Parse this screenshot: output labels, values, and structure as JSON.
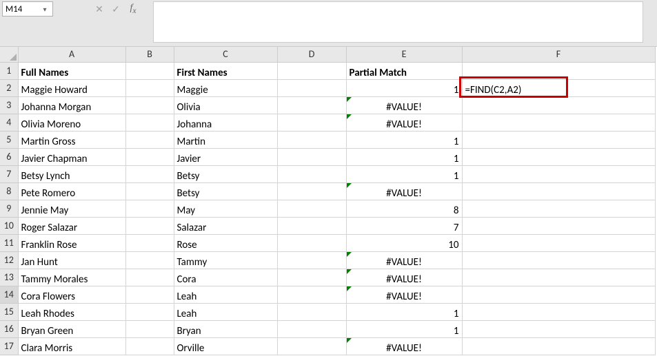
{
  "name_box": "M14",
  "formula_input": "",
  "col_headers": [
    "A",
    "B",
    "C",
    "D",
    "E",
    "F"
  ],
  "col_widths": [
    "col-A",
    "col-B",
    "col-C",
    "col-D",
    "col-E",
    "col-F"
  ],
  "rows": [
    {
      "n": 1,
      "A": "Full Names",
      "C": "First Names",
      "E": "Partial Match",
      "bold": true
    },
    {
      "n": 2,
      "A": "Maggie Howard",
      "C": "Maggie",
      "E": "1",
      "E_right": true,
      "F": "=FIND(C2,A2)",
      "hl": true
    },
    {
      "n": 3,
      "A": "Johanna Morgan",
      "C": "Olivia",
      "E": "#VALUE!",
      "E_center": true,
      "E_err": true
    },
    {
      "n": 4,
      "A": "Olivia Moreno",
      "C": "Johanna",
      "E": "#VALUE!",
      "E_center": true,
      "E_err": true
    },
    {
      "n": 5,
      "A": "Martin Gross",
      "C": "Martin",
      "E": "1",
      "E_right": true
    },
    {
      "n": 6,
      "A": "Javier Chapman",
      "C": "Javier",
      "E": "1",
      "E_right": true
    },
    {
      "n": 7,
      "A": "Betsy Lynch",
      "C": "Betsy",
      "E": "1",
      "E_right": true
    },
    {
      "n": 8,
      "A": "Pete Romero",
      "C": "Betsy",
      "E": "#VALUE!",
      "E_center": true,
      "E_err": true
    },
    {
      "n": 9,
      "A": "Jennie May",
      "C": "May",
      "E": "8",
      "E_right": true
    },
    {
      "n": 10,
      "A": "Roger Salazar",
      "C": "Salazar",
      "E": "7",
      "E_right": true
    },
    {
      "n": 11,
      "A": "Franklin Rose",
      "C": "Rose",
      "E": "10",
      "E_right": true
    },
    {
      "n": 12,
      "A": "Jan Hunt",
      "C": "Tammy",
      "E": "#VALUE!",
      "E_center": true,
      "E_err": true
    },
    {
      "n": 13,
      "A": "Tammy Morales",
      "C": "Cora",
      "E": "#VALUE!",
      "E_center": true,
      "E_err": true
    },
    {
      "n": 14,
      "A": "Cora Flowers",
      "C": "Leah",
      "E": "#VALUE!",
      "E_center": true,
      "E_err": true,
      "sel": true
    },
    {
      "n": 15,
      "A": "Leah Rhodes",
      "C": "Leah",
      "E": "1",
      "E_right": true
    },
    {
      "n": 16,
      "A": "Bryan Green",
      "C": "Bryan",
      "E": "1",
      "E_right": true
    },
    {
      "n": 17,
      "A": "Clara Morris",
      "C": "Orville",
      "E": "#VALUE!",
      "E_center": true,
      "E_err": true
    }
  ],
  "icons": {
    "cancel": "✕",
    "enter": "✓",
    "dd": "▾"
  },
  "chart_data": {
    "type": "table",
    "title": "FIND partial-match example",
    "columns": [
      "Full Names",
      "First Names",
      "Partial Match"
    ],
    "annotation_formula": "=FIND(C2,A2)",
    "data": [
      {
        "full": "Maggie Howard",
        "first": "Maggie",
        "match": 1
      },
      {
        "full": "Johanna Morgan",
        "first": "Olivia",
        "match": "#VALUE!"
      },
      {
        "full": "Olivia Moreno",
        "first": "Johanna",
        "match": "#VALUE!"
      },
      {
        "full": "Martin Gross",
        "first": "Martin",
        "match": 1
      },
      {
        "full": "Javier Chapman",
        "first": "Javier",
        "match": 1
      },
      {
        "full": "Betsy Lynch",
        "first": "Betsy",
        "match": 1
      },
      {
        "full": "Pete Romero",
        "first": "Betsy",
        "match": "#VALUE!"
      },
      {
        "full": "Jennie May",
        "first": "May",
        "match": 8
      },
      {
        "full": "Roger Salazar",
        "first": "Salazar",
        "match": 7
      },
      {
        "full": "Franklin Rose",
        "first": "Rose",
        "match": 10
      },
      {
        "full": "Jan Hunt",
        "first": "Tammy",
        "match": "#VALUE!"
      },
      {
        "full": "Tammy Morales",
        "first": "Cora",
        "match": "#VALUE!"
      },
      {
        "full": "Cora Flowers",
        "first": "Leah",
        "match": "#VALUE!"
      },
      {
        "full": "Leah Rhodes",
        "first": "Leah",
        "match": 1
      },
      {
        "full": "Bryan Green",
        "first": "Bryan",
        "match": 1
      },
      {
        "full": "Clara Morris",
        "first": "Orville",
        "match": "#VALUE!"
      }
    ]
  }
}
